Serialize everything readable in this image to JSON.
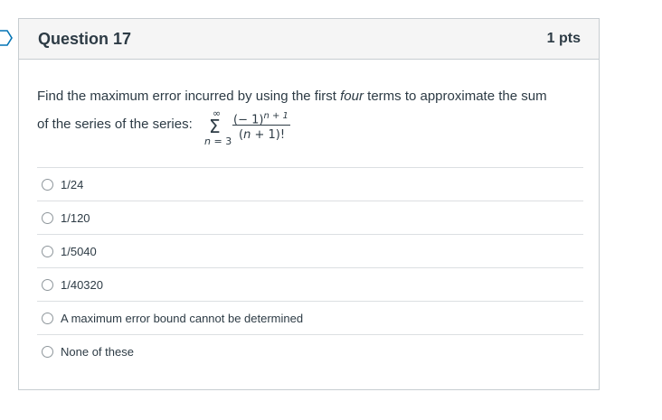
{
  "header": {
    "title": "Question 17",
    "points": "1 pts"
  },
  "question": {
    "text_before": "Find the maximum error incurred by using the first ",
    "text_emphasis": "four",
    "text_after": " terms to approximate the sum",
    "line2": "of the series of the series:",
    "formula": {
      "sum_symbol": "Σ",
      "upper": "∞",
      "lower_var": "n",
      "lower_eq": " = 3",
      "numerator_base": "(− 1)",
      "numerator_exp": "n + 1",
      "denominator_open": "(",
      "denominator_var": "n",
      "denominator_rest": " + 1)!"
    }
  },
  "answers": [
    {
      "label": "1/24"
    },
    {
      "label": "1/120"
    },
    {
      "label": "1/5040"
    },
    {
      "label": "1/40320"
    },
    {
      "label": "A maximum error bound cannot be determined"
    },
    {
      "label": "None of these"
    }
  ],
  "colors": {
    "text": "#2d3b45",
    "header_bg": "#f5f5f5",
    "border": "#c7cdd1",
    "flag": "#0374b5"
  }
}
